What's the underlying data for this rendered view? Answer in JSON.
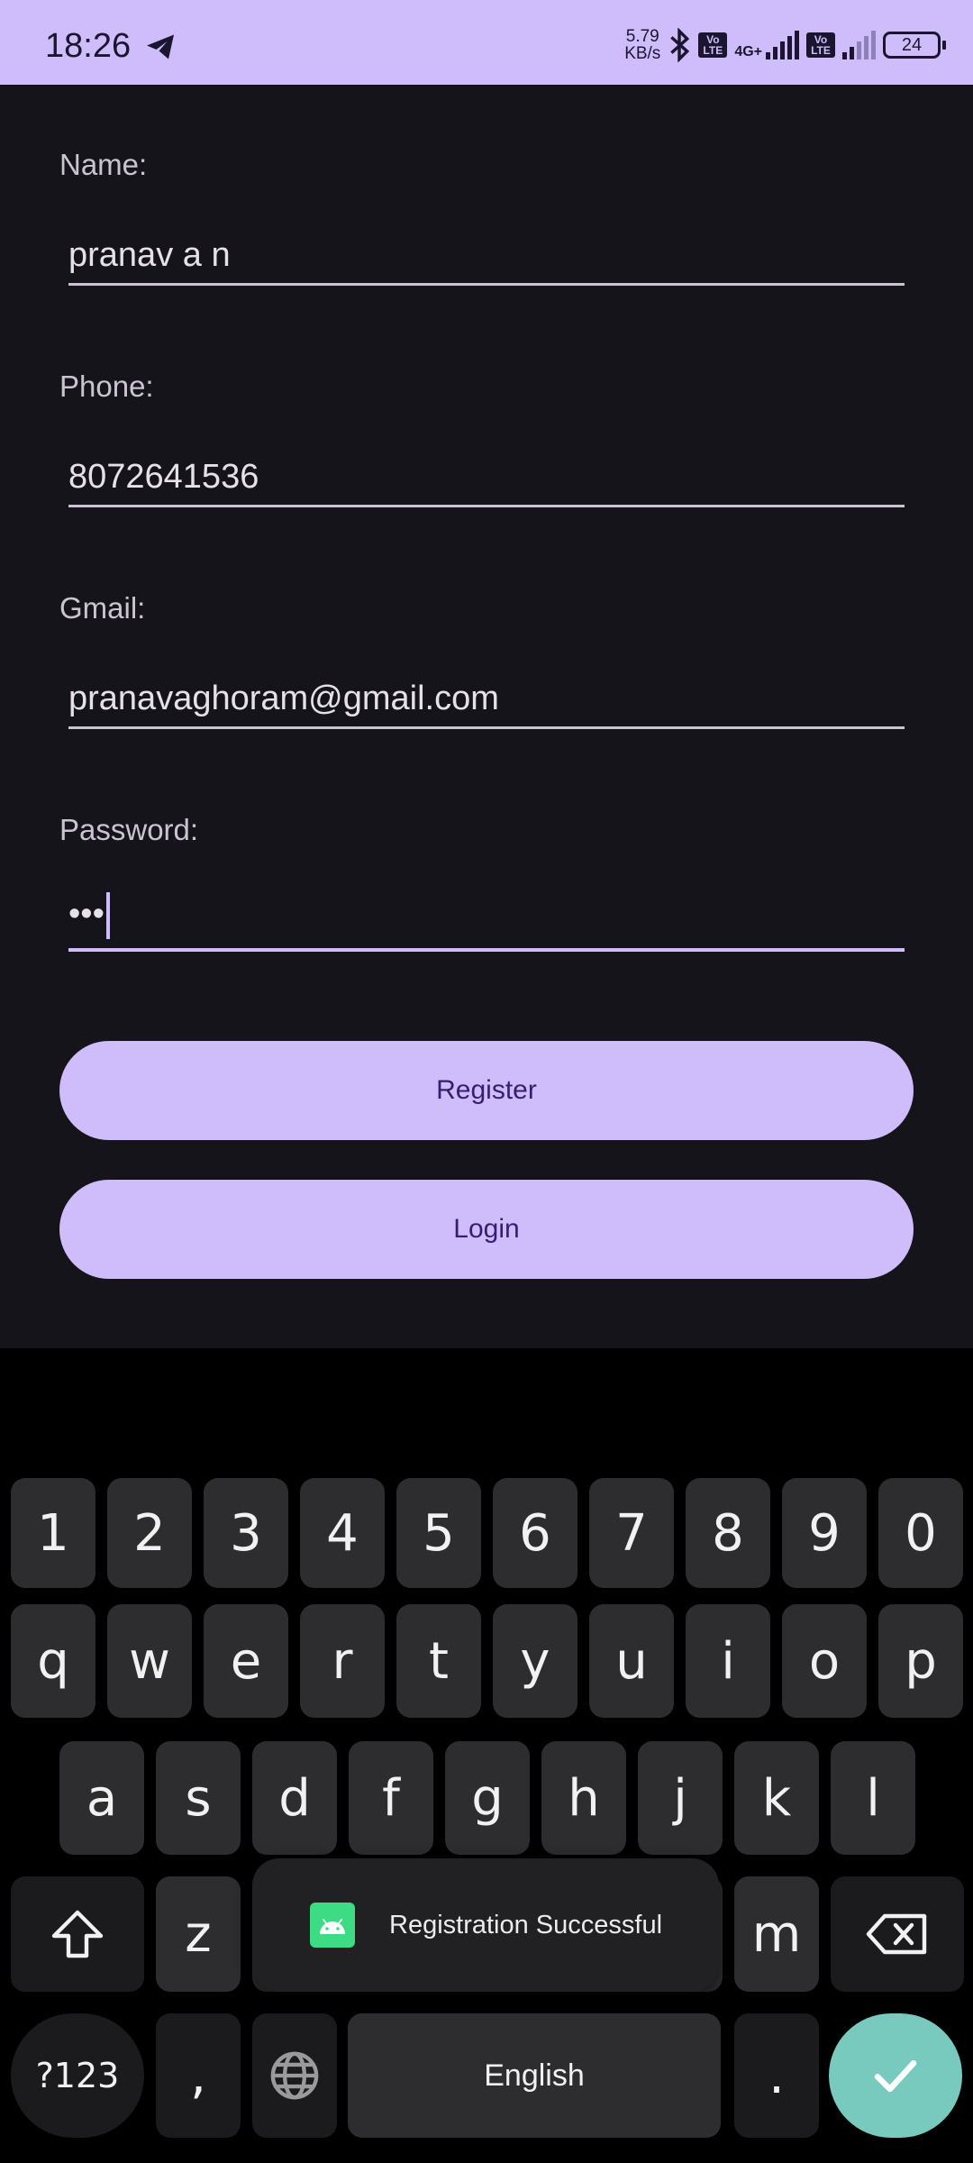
{
  "status_bar": {
    "time": "18:26",
    "net_speed_value": "5.79",
    "net_speed_unit": "KB/s",
    "volte_label": "Vo LTE",
    "network_type": "4G+",
    "battery": "24"
  },
  "form": {
    "name": {
      "label": "Name:",
      "value": "pranav a n"
    },
    "phone": {
      "label": "Phone:",
      "value": "8072641536"
    },
    "gmail": {
      "label": "Gmail:",
      "value": "pranavaghoram@gmail.com"
    },
    "password": {
      "label": "Password:",
      "value": "•••"
    }
  },
  "buttons": {
    "register": "Register",
    "login": "Login"
  },
  "keyboard": {
    "number_row": [
      "1",
      "2",
      "3",
      "4",
      "5",
      "6",
      "7",
      "8",
      "9",
      "0"
    ],
    "row1": [
      "q",
      "w",
      "e",
      "r",
      "t",
      "y",
      "u",
      "i",
      "o",
      "p"
    ],
    "row2": [
      "a",
      "s",
      "d",
      "f",
      "g",
      "h",
      "j",
      "k",
      "l"
    ],
    "row3_visible": [
      "z",
      "m"
    ],
    "symbols_label": "?123",
    "comma": ",",
    "space_label": "English",
    "period": "."
  },
  "toast": {
    "message": "Registration Successful"
  },
  "colors": {
    "accent": "#cfbdfb",
    "background": "#16141b",
    "enter_key": "#78cabf"
  }
}
